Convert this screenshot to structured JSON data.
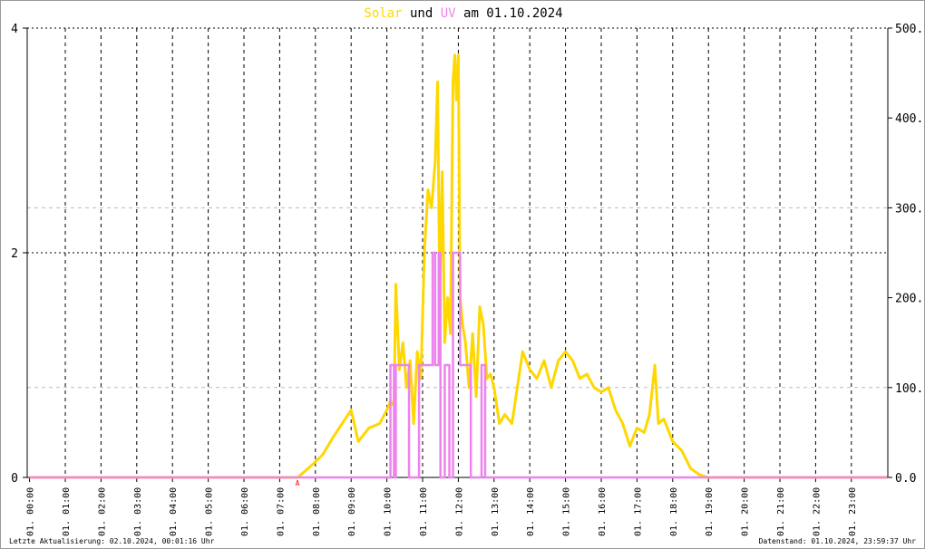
{
  "title": {
    "part1": "Solar",
    "part2": "und",
    "part3": "UV",
    "part4": "am 01.10.2024"
  },
  "footer": {
    "left": "Letzte Aktualisierung: 02.10.2024, 00:01:16 Uhr",
    "right": "Datenstand: 01.10.2024, 23:59:37 Uhr"
  },
  "colors": {
    "solar": "#ffd700",
    "uv": "#ee82ee",
    "marker": "#ff0000"
  },
  "chart_data": {
    "type": "line",
    "title": "Solar und UV am 01.10.2024",
    "x_unit": "hour",
    "xlim": [
      0,
      24
    ],
    "x_tick_labels": [
      "01. 00:00",
      "01. 01:00",
      "01. 02:00",
      "01. 03:00",
      "01. 04:00",
      "01. 05:00",
      "01. 06:00",
      "01. 07:00",
      "01. 08:00",
      "01. 09:00",
      "01. 10:00",
      "01. 11:00",
      "01. 12:00",
      "01. 13:00",
      "01. 14:00",
      "01. 15:00",
      "01. 16:00",
      "01. 17:00",
      "01. 18:00",
      "01. 19:00",
      "01. 20:00",
      "01. 21:00",
      "01. 22:00",
      "01. 23:00"
    ],
    "y_left": {
      "label": "UV",
      "ylim": [
        0,
        4
      ],
      "ticks": [
        "0",
        "2",
        "4"
      ]
    },
    "y_right": {
      "label": "Solar",
      "ylim": [
        0,
        500
      ],
      "ticks": [
        "0.0",
        "100.0",
        "200.0",
        "300.0",
        "400.0",
        "500.0"
      ]
    },
    "marker": {
      "x": 7.5,
      "label": "A"
    },
    "series": [
      {
        "name": "Solar",
        "axis": "right",
        "x": [
          0,
          7.5,
          7.8,
          8.2,
          8.5,
          8.75,
          9.0,
          9.2,
          9.5,
          9.8,
          10.0,
          10.1,
          10.2,
          10.25,
          10.35,
          10.45,
          10.55,
          10.65,
          10.75,
          10.85,
          10.95,
          11.05,
          11.15,
          11.25,
          11.35,
          11.42,
          11.48,
          11.55,
          11.62,
          11.7,
          11.78,
          11.85,
          11.9,
          11.95,
          12.0,
          12.05,
          12.12,
          12.2,
          12.3,
          12.4,
          12.5,
          12.6,
          12.7,
          12.8,
          12.9,
          13.0,
          13.15,
          13.3,
          13.5,
          13.65,
          13.8,
          14.0,
          14.2,
          14.4,
          14.6,
          14.8,
          15.0,
          15.2,
          15.4,
          15.6,
          15.8,
          16.0,
          16.2,
          16.4,
          16.6,
          16.8,
          17.0,
          17.2,
          17.35,
          17.5,
          17.6,
          17.75,
          18.0,
          18.25,
          18.5,
          18.75,
          19.0,
          24
        ],
        "values": [
          0,
          0,
          10,
          25,
          45,
          60,
          75,
          40,
          55,
          60,
          75,
          85,
          80,
          215,
          120,
          150,
          100,
          130,
          60,
          140,
          110,
          250,
          320,
          300,
          350,
          440,
          200,
          340,
          150,
          200,
          160,
          440,
          470,
          420,
          470,
          200,
          170,
          150,
          100,
          160,
          90,
          190,
          170,
          110,
          115,
          100,
          60,
          70,
          60,
          100,
          140,
          120,
          110,
          130,
          100,
          130,
          140,
          130,
          110,
          115,
          100,
          95,
          100,
          75,
          60,
          35,
          55,
          50,
          70,
          125,
          60,
          65,
          40,
          30,
          10,
          3,
          0,
          0
        ]
      },
      {
        "name": "UV",
        "axis": "left",
        "step": true,
        "x": [
          0,
          10.1,
          10.2,
          10.25,
          10.55,
          10.62,
          10.9,
          11.05,
          11.15,
          11.2,
          11.28,
          11.35,
          11.45,
          11.5,
          11.62,
          11.75,
          11.85,
          12.0,
          12.05,
          12.25,
          12.35,
          12.65,
          12.75,
          12.85,
          24
        ],
        "values": [
          0,
          1,
          0,
          1,
          1,
          0,
          1,
          1,
          1,
          1,
          2,
          1,
          2,
          0,
          1,
          0,
          2,
          2,
          1,
          1,
          0,
          1,
          0,
          0,
          0
        ]
      }
    ]
  }
}
